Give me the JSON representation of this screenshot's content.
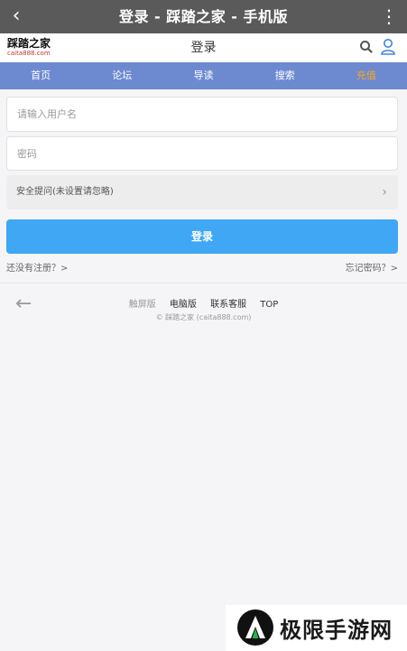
{
  "topbar": {
    "back_glyph": "‹",
    "title": "登录 - 踩踏之家 - 手机版",
    "more_glyph": "⋮"
  },
  "header": {
    "logo_main": "踩踏之家",
    "logo_sub": "caita888.com",
    "title": "登录",
    "icons": [
      "search-icon",
      "user-icon"
    ],
    "accent_color": "#3d85e0"
  },
  "nav": {
    "items": [
      "首页",
      "论坛",
      "导读",
      "搜索",
      "充值"
    ],
    "bg_color": "#6d8ad1",
    "accent_color": "#f5a623"
  },
  "form": {
    "username_placeholder": "请输入用户名",
    "password_placeholder": "密码",
    "security_question": "安全提问(未设置请忽略)",
    "submit_label": "登录",
    "submit_color": "#3fa7f4"
  },
  "links": {
    "register": "还没有注册？>",
    "forgot": "忘记密码？>"
  },
  "footer": {
    "back_glyph": "←",
    "links": [
      "触屏版",
      "电脑版",
      "联系客服",
      "TOP"
    ],
    "copyright": "© 踩踏之家 (caita888.com)"
  },
  "watermark": {
    "text": "极限手游网"
  }
}
